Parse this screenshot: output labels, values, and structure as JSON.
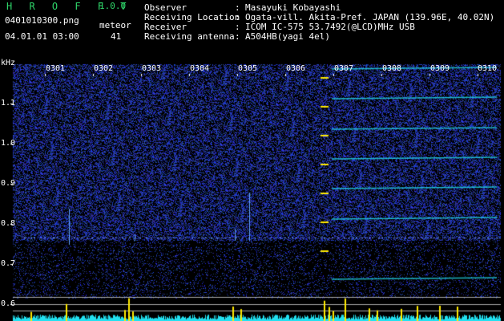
{
  "header": {
    "app_title": "H R O F F T",
    "app_version": "1.0.0",
    "file_name": "0401010300.png",
    "meteor_label": "meteor",
    "datetime": "04.01.01 03:00",
    "meteor_count": "41"
  },
  "info": [
    {
      "label": "Observer",
      "value": "Masayuki Kobayashi"
    },
    {
      "label": "Receiving Location",
      "value": "Ogata-vill. Akita-Pref. JAPAN (139.96E, 40.02N)"
    },
    {
      "label": "Receiver",
      "value": "ICOM IC-575 53.7492(@LCD)MHz USB"
    },
    {
      "label": "Receiving antenna",
      "value": "A504HB(yagi 4el)"
    }
  ],
  "info_separator": ":",
  "spectrogram": {
    "y_unit": "kHz",
    "y_ticks": [
      "1.1",
      "1.0",
      "0.9",
      "0.8",
      "0.7",
      "0.6"
    ],
    "time_ticks": [
      "0301",
      "0302",
      "0303",
      "0304",
      "0305",
      "0306",
      "0307",
      "0308",
      "0309",
      "0310"
    ],
    "colors": {
      "background": "#000000",
      "noise": "#1a2fb8",
      "trace": "#ffe900",
      "signal": "#22e0f0",
      "grid": "#aaaaaa"
    }
  }
}
